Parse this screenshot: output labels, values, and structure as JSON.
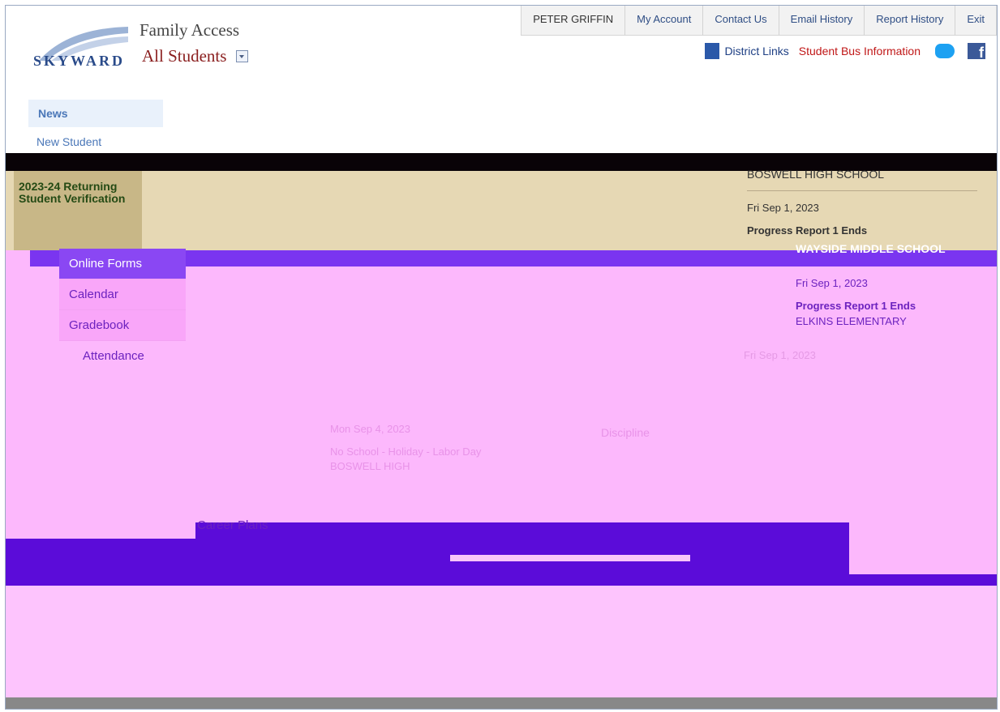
{
  "header": {
    "app_name": "Family Access",
    "logo_text": "SKYWARD",
    "student_selector": "All Students",
    "top_nav": [
      "PETER GRIFFIN",
      "My Account",
      "Contact Us",
      "Email History",
      "Report History",
      "Exit"
    ],
    "district_links": "District Links",
    "bus_info": "Student Bus Information",
    "twitter_icon": "twitter-icon",
    "facebook_icon": "facebook-icon",
    "facebook_glyph": "f"
  },
  "news": {
    "tab_label": "News",
    "new_student": "New Student"
  },
  "sidebar": {
    "verification_label": "2023-24 Returning Student Verification",
    "items": [
      {
        "label": "Online Forms",
        "active": true
      },
      {
        "label": "Calendar",
        "active": false
      },
      {
        "label": "Gradebook",
        "active": false
      }
    ],
    "attendance": "Attendance",
    "career": "Career Plans"
  },
  "events": [
    {
      "school": "BOSWELL HIGH SCHOOL",
      "date": "Fri Sep 1, 2023",
      "title": "Progress Report 1 Ends"
    },
    {
      "school": "WAYSIDE MIDDLE SCHOOL",
      "date": "Fri Sep 1, 2023",
      "title": "Progress Report 1 Ends",
      "school2": "ELKINS ELEMENTARY"
    },
    {
      "date": "Fri Sep 1, 2023"
    }
  ],
  "center_event": {
    "date": "Mon Sep 4, 2023",
    "title": "No School - Holiday - Labor Day",
    "school": "BOSWELL HIGH"
  },
  "discipline_label": "Discipline",
  "colors": {
    "tan": "#e6d8b4",
    "magenta": "#fcb8fc",
    "purple": "#5b0cd9",
    "menu_active": "#8a47f3"
  }
}
